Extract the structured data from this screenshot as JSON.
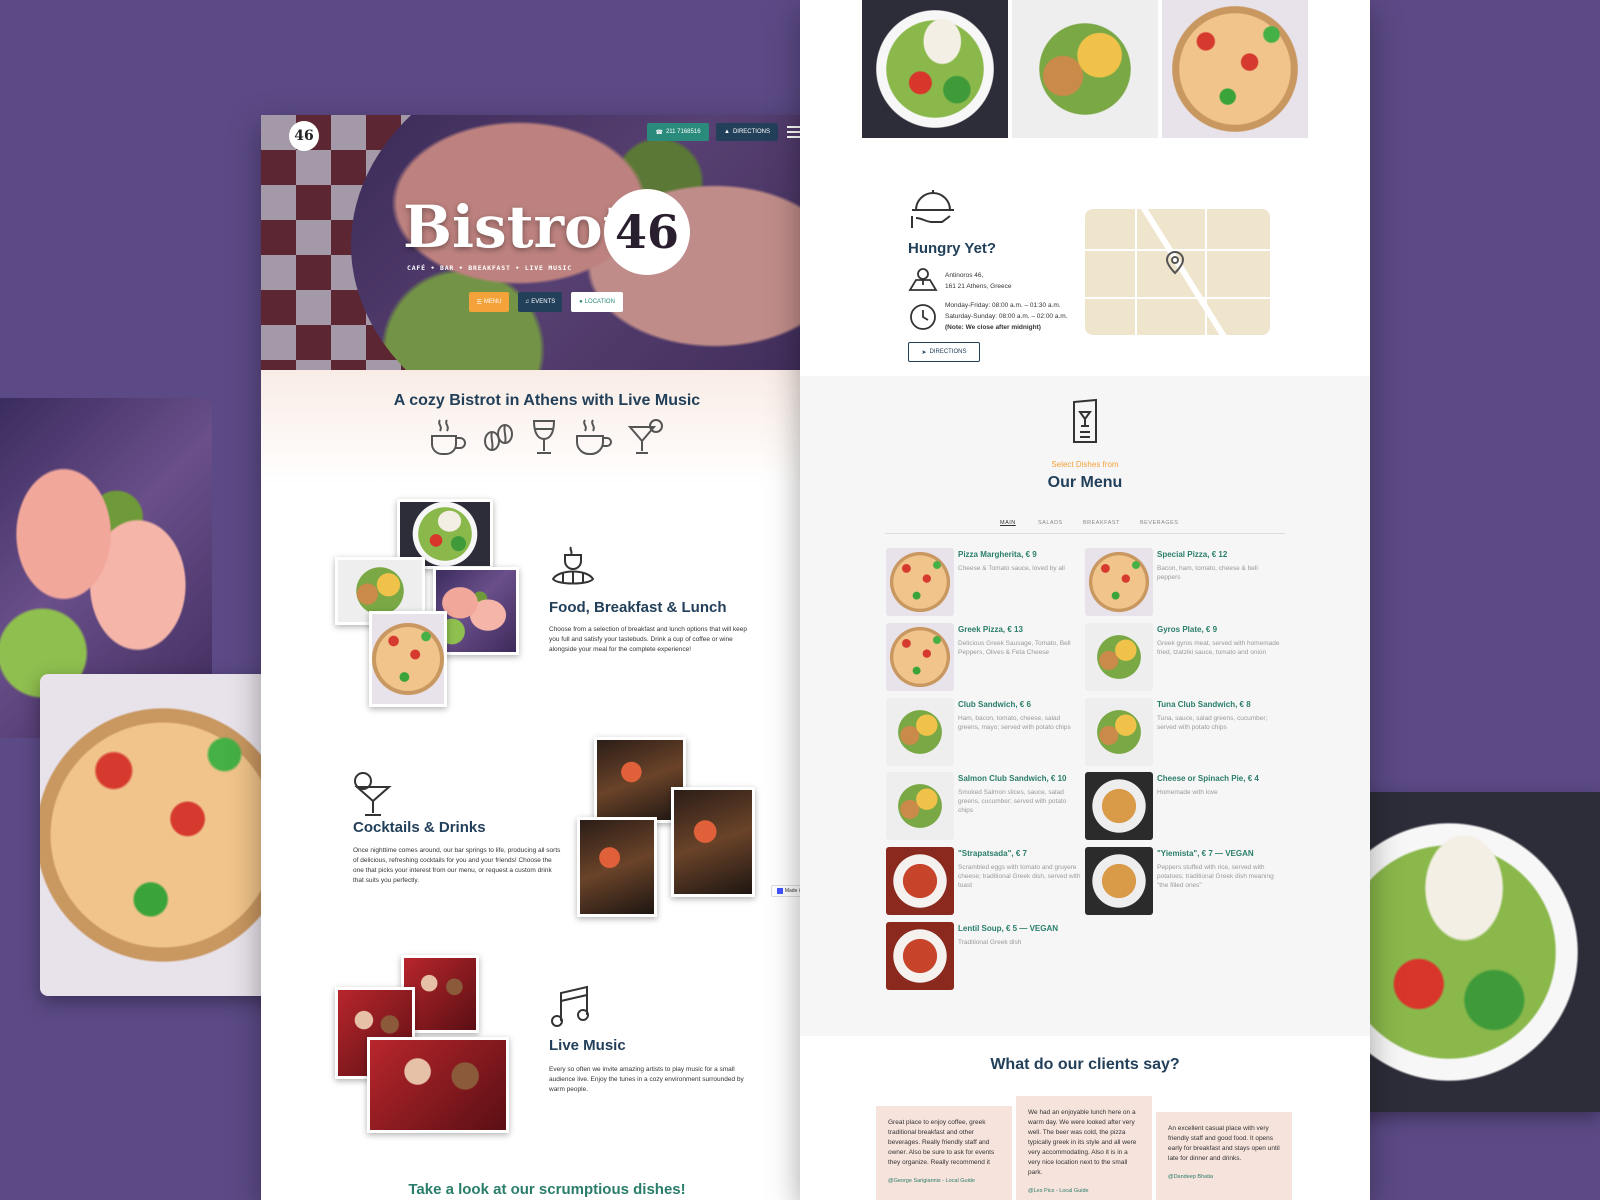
{
  "hero": {
    "logo": "46",
    "phone_label": "211 7168516",
    "directions_label": "DIRECTIONS",
    "brand_word": "Bistrot",
    "brand_number": "46",
    "tagline": "CAFÉ • BAR • BREAKFAST • LIVE MUSIC",
    "menu_button": "MENU",
    "events_button": "EVENTS",
    "location_button": "LOCATION"
  },
  "intro": {
    "heading": "A cozy Bistrot in Athens with Live Music"
  },
  "food": {
    "heading": "Food, Breakfast & Lunch",
    "text": "Choose from a selection of breakfast and lunch options that will keep you full and satisfy your tastebuds. Drink a cup of coffee or wine alongside your meal for the complete experience!"
  },
  "cocktails": {
    "heading": "Cocktails & Drinks",
    "text": "Once nighttime comes around, our bar springs to life, producing all sorts of delicious, refreshing cocktails for you and your friends! Choose the one that picks your interest from our menu, or request a custom drink that suits you perfectly.",
    "badge": "Made in Webflow"
  },
  "music": {
    "heading": "Live Music",
    "text": "Every so often we invite amazing artists to play music for a small audience live. Enjoy the tunes in a cozy environment surrounded by warm people."
  },
  "gallery_heading": "Take a look at our scrumptious dishes!",
  "info": {
    "heading": "Hungry Yet?",
    "address_line1": "Antinoros 46,",
    "address_line2": "161 21 Athens, Greece",
    "hours_line1": "Monday-Friday: 08:00 a.m. – 01:30 a.m.",
    "hours_line2": "Saturday-Sunday: 08:00 a.m. – 02:00 a.m.",
    "hours_note": "(Note: We close after midnight)",
    "directions_button": "DIRECTIONS"
  },
  "menu": {
    "kicker": "Select Dishes from",
    "heading": "Our Menu",
    "tabs": [
      "MAIN",
      "SALADS",
      "BREAKFAST",
      "BEVERAGES"
    ],
    "items": [
      {
        "name": "Pizza Margherita, € 9",
        "desc": "Cheese & Tomato sauce, loved by all"
      },
      {
        "name": "Special Pizza, € 12",
        "desc": "Bacon, ham, tomato, cheese & bell peppers"
      },
      {
        "name": "Greek Pizza, € 13",
        "desc": "Delicious Greek Sausage, Tomato, Bell Peppers, Olives & Feta Cheese"
      },
      {
        "name": "Gyros Plate, € 9",
        "desc": "Greek gyros meat, served with homemade fried, tzatziki sauce, tomato and onion"
      },
      {
        "name": "Club Sandwich, € 6",
        "desc": "Ham, bacon, tomato, cheese, salad greens, mayo; served with potato chips"
      },
      {
        "name": "Tuna Club Sandwich, € 8",
        "desc": "Tuna, sauce, salad greens, cucumber; served with potato chips"
      },
      {
        "name": "Salmon Club Sandwich, € 10",
        "desc": "Smoked Salmon slices, sauce, salad greens, cucumber; served with potato chips"
      },
      {
        "name": "Cheese or Spinach Pie, € 4",
        "desc": "Homemade with love"
      },
      {
        "name": "\"Strapatsada\", € 7",
        "desc": "Scrambled eggs with tomato and gruyere cheese; traditional Greek dish, served with toast"
      },
      {
        "name": "\"Yiemista\", € 7 — VEGAN",
        "desc": "Peppers stuffed with rice, served with potatoes; traditional Greek dish meaning \"the filled ones\""
      },
      {
        "name": "Lentil Soup, € 5 — VEGAN",
        "desc": "Traditional Greek dish"
      }
    ]
  },
  "reviews": {
    "heading": "What do our clients say?",
    "items": [
      {
        "text": "Great place to enjoy coffee, greek traditional breakfast and other beverages. Really friendly staff and owner. Also be sure to ask for events they organize. Really recommend it",
        "author": "@George Sarigiannis - Local Guide"
      },
      {
        "text": "We had an enjoyable lunch here on a warm day. We were looked after very well. The beer was cold, the pizza typically greek in its style and all were very accommodating. Also it is in a very nice location next to the small park.",
        "author": "@Les Pics - Local Guide"
      },
      {
        "text": "An excellent casual place with very friendly staff and good food. It opens early for breakfast and stays open until late for dinner and drinks.",
        "author": "@Dandeep Bhatia"
      }
    ]
  },
  "colors": {
    "background": "#5c4a86",
    "navy": "#23405a",
    "teal": "#2a8a7c",
    "orange": "#f4a23a",
    "cream": "#f9ece6"
  }
}
